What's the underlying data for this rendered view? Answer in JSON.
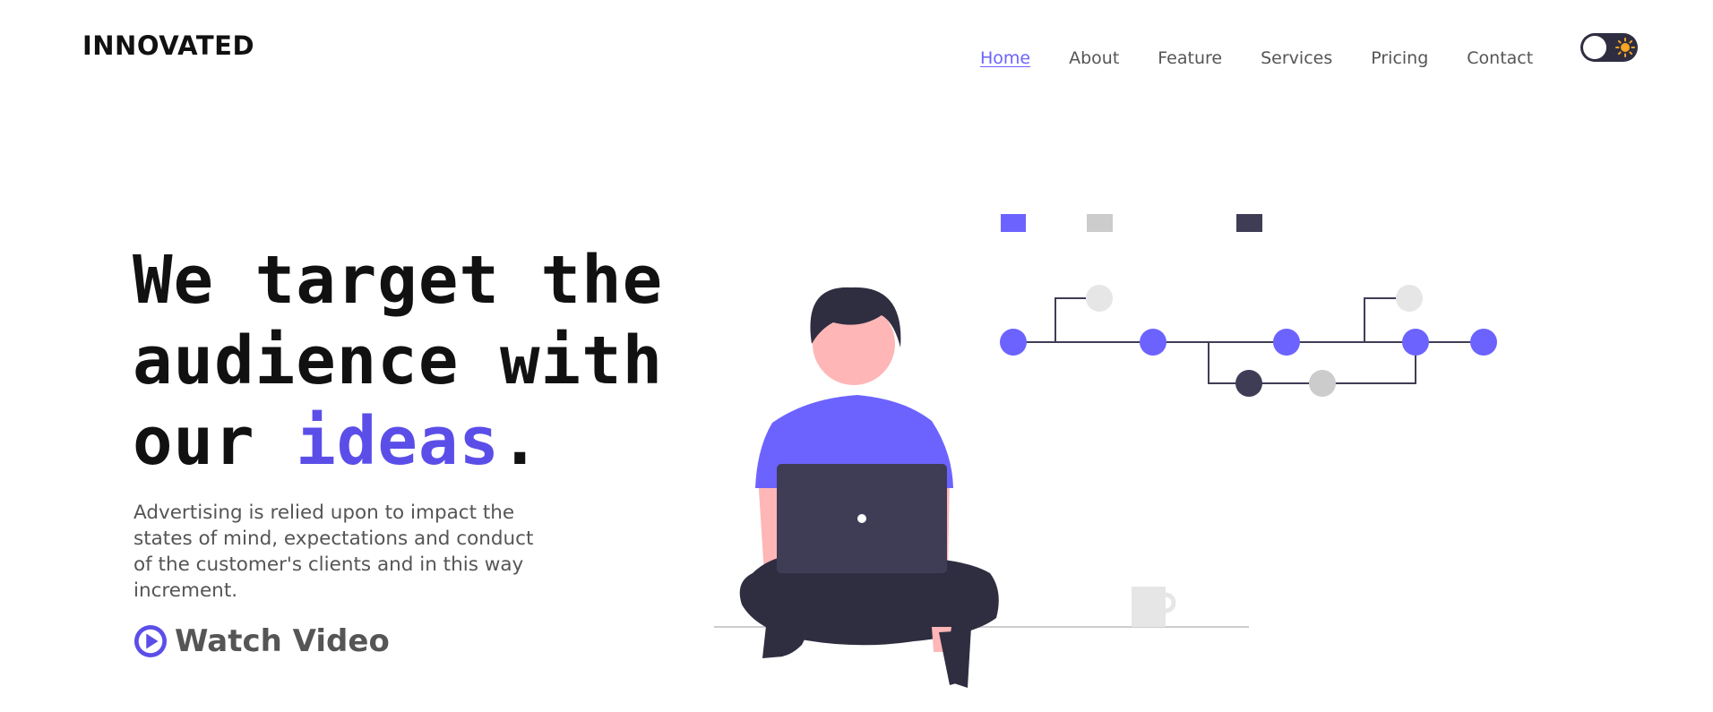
{
  "brand": {
    "name": "INNOVATED"
  },
  "nav": {
    "items": [
      {
        "label": "Home",
        "active": true
      },
      {
        "label": "About",
        "active": false
      },
      {
        "label": "Feature",
        "active": false
      },
      {
        "label": "Services",
        "active": false
      },
      {
        "label": "Pricing",
        "active": false
      },
      {
        "label": "Contact",
        "active": false
      }
    ]
  },
  "theme_toggle": {
    "icon": "sun-icon",
    "state": "light"
  },
  "hero": {
    "headline_line1": "We target the",
    "headline_line2": "audience with",
    "headline_line3_prefix": "our ",
    "headline_accent": "ideas",
    "headline_suffix": ".",
    "description": "Advertising is relied upon to impact the states of mind, expectations and conduct of the customer's clients and in this way increment.",
    "cta_label": "Watch Video",
    "cta_icon": "play-circle-icon"
  },
  "colors": {
    "accent": "#6c63ff",
    "accent_text": "#5b4ee8",
    "dark": "#2f2e41",
    "muted_text": "#555555",
    "skin": "#ffb6b6",
    "light_gray": "#e6e6e6",
    "mid_gray": "#cccccc",
    "sun": "#f5a623"
  }
}
